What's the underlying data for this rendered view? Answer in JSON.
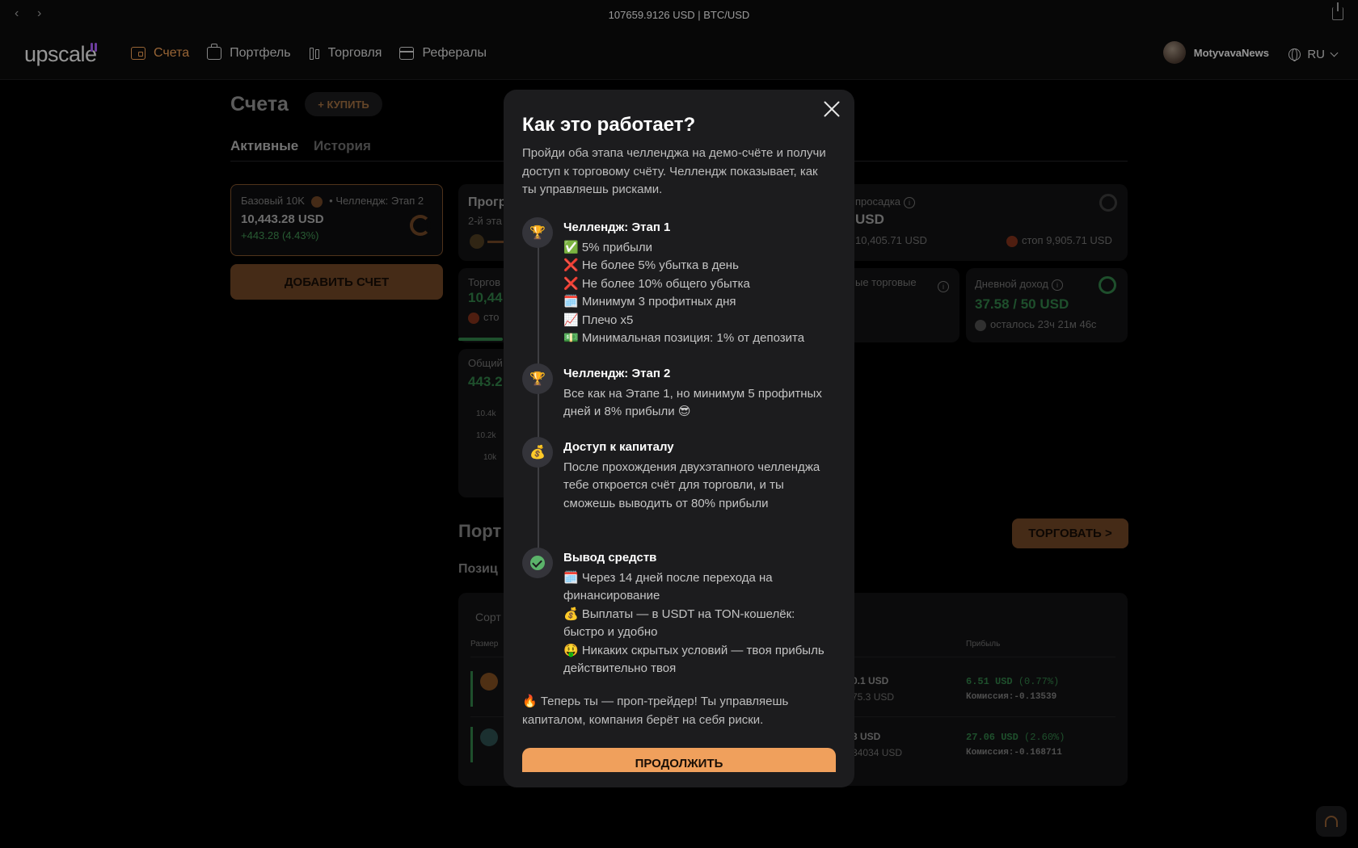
{
  "browser": {
    "title": "107659.9126 USD | BTC/USD"
  },
  "header": {
    "logo": "upscale",
    "nav": [
      "Счета",
      "Портфель",
      "Торговля",
      "Рефералы"
    ],
    "user_name": "MotyvavaNews",
    "lang": "RU"
  },
  "accounts": {
    "title": "Счета",
    "buy_label": "+ КУПИТЬ",
    "tab_active": "Активные",
    "tab_history": "История",
    "card": {
      "label": "Базовый 10K",
      "stage": "• Челлендж: Этап 2",
      "balance": "10,443.28 USD",
      "gain": "+443.28 (4.43%)"
    },
    "add_label": "ДОБАВИТЬ СЧЕТ"
  },
  "dashboard": {
    "progress_label": "Прогр",
    "progress_sub": "2-й эта",
    "drawdown_label": "просадка",
    "drawdown_value": "USD",
    "drawdown_min": "10,405.71 USD",
    "drawdown_stop": "стоп 9,905.71 USD",
    "trading_label": "Торгов",
    "trading_value": "10,44",
    "trading_stop": "сто",
    "trading_days_label": "ые торговые",
    "daily_label": "Дневной доход",
    "daily_value": "37.58 / 50 USD",
    "daily_left": "осталось 23ч 21м 46с",
    "total_label": "Общий",
    "total_value": "443.2",
    "ticks": [
      "10.4k",
      "10.2k",
      "10k"
    ],
    "trade_button": "ТОРГОВАТЬ >",
    "portfolio_title": "Порт",
    "positions_title": "Позиц",
    "sort_label": "Сорт",
    "size_label": "Размер",
    "profit_label": "Прибыль",
    "rows": [
      {
        "value": "0.1 USD",
        "sub": "75.3 USD",
        "profit": "6.51 USD",
        "profit_pct": "(0.77%)",
        "commission": "Комиссия:-0.13539"
      },
      {
        "value": "3 USD",
        "sub": "34034 USD",
        "profit": "27.06 USD",
        "profit_pct": "(2.60%)",
        "commission": "Комиссия:-0.168711"
      }
    ]
  },
  "modal": {
    "title": "Как это работает?",
    "intro": "Пройди оба этапа челленджа на демо-счёте и получи доступ к торговому счёту. Челлендж показывает, как ты управляешь рисками.",
    "steps": [
      {
        "icon": "trophy-icon",
        "title": "Челлендж: Этап 1",
        "lines": [
          "✅ 5% прибыли",
          "❌ Не более 5% убытка в день",
          "❌ Не более 10% общего убытка",
          "🗓️ Минимум 3 профитных дня",
          "📈 Плечо x5",
          "💵 Минимальная позиция: 1% от депозита"
        ]
      },
      {
        "icon": "trophy-icon",
        "title": "Челлендж: Этап 2",
        "lines": [
          "Все как на Этапе 1, но минимум 5 профитных дней и 8% прибыли 😎"
        ]
      },
      {
        "icon": "money-bag-icon",
        "title": "Доступ к капиталу",
        "lines": [
          "После прохождения двухэтапного челленджа тебе откроется счёт для торговли, и ты сможешь выводить от 80% прибыли"
        ]
      },
      {
        "icon": "check-icon",
        "title": "Вывод средств",
        "lines": [
          "🗓️ Через 14 дней после перехода на финансирование",
          "💰 Выплаты — в USDT на TON-кошелёк: быстро и удобно",
          "🤑 Никаких скрытых условий — твоя прибыль действительно твоя"
        ]
      }
    ],
    "footer": "🔥 Теперь ты — проп-трейдер! Ты управляешь капиталом, компания берёт на себя риски.",
    "continue_label": "ПРОДОЛЖИТЬ"
  },
  "colors": {
    "accent": "#e89a52",
    "button": "#f0a05c",
    "green": "#5bb36a",
    "modal_bg": "#1c1c1e"
  }
}
